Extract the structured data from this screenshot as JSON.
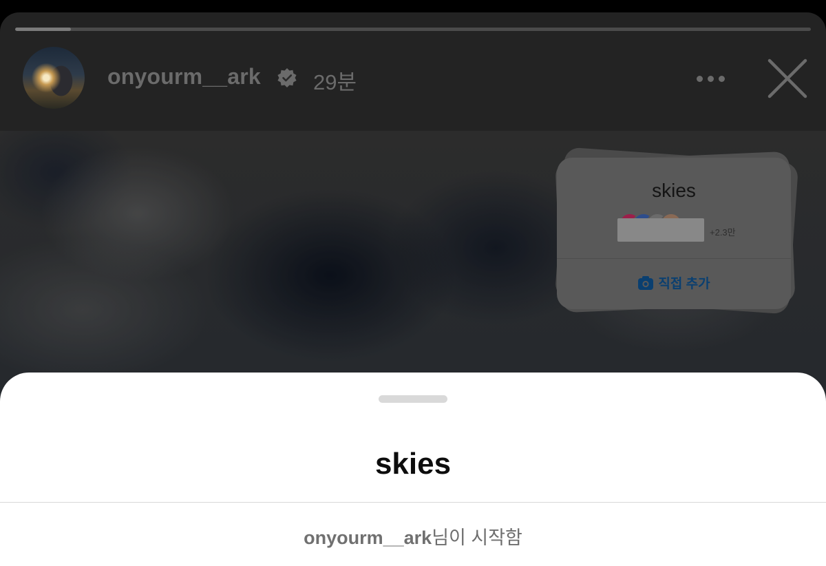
{
  "story": {
    "progress": 0.07,
    "username": "onyourm__ark",
    "verified": true,
    "time_ago": "29분",
    "more_icon": "more-horizontal-icon",
    "close_icon": "close-icon"
  },
  "sticker": {
    "title": "skies",
    "participant_count": "+2.3만",
    "add_label": "직접 추가",
    "add_icon": "camera-icon",
    "accent_color": "#0a3f70"
  },
  "sheet": {
    "title": "skies",
    "creator": "onyourm__ark",
    "started_suffix": "님이 시작함"
  }
}
